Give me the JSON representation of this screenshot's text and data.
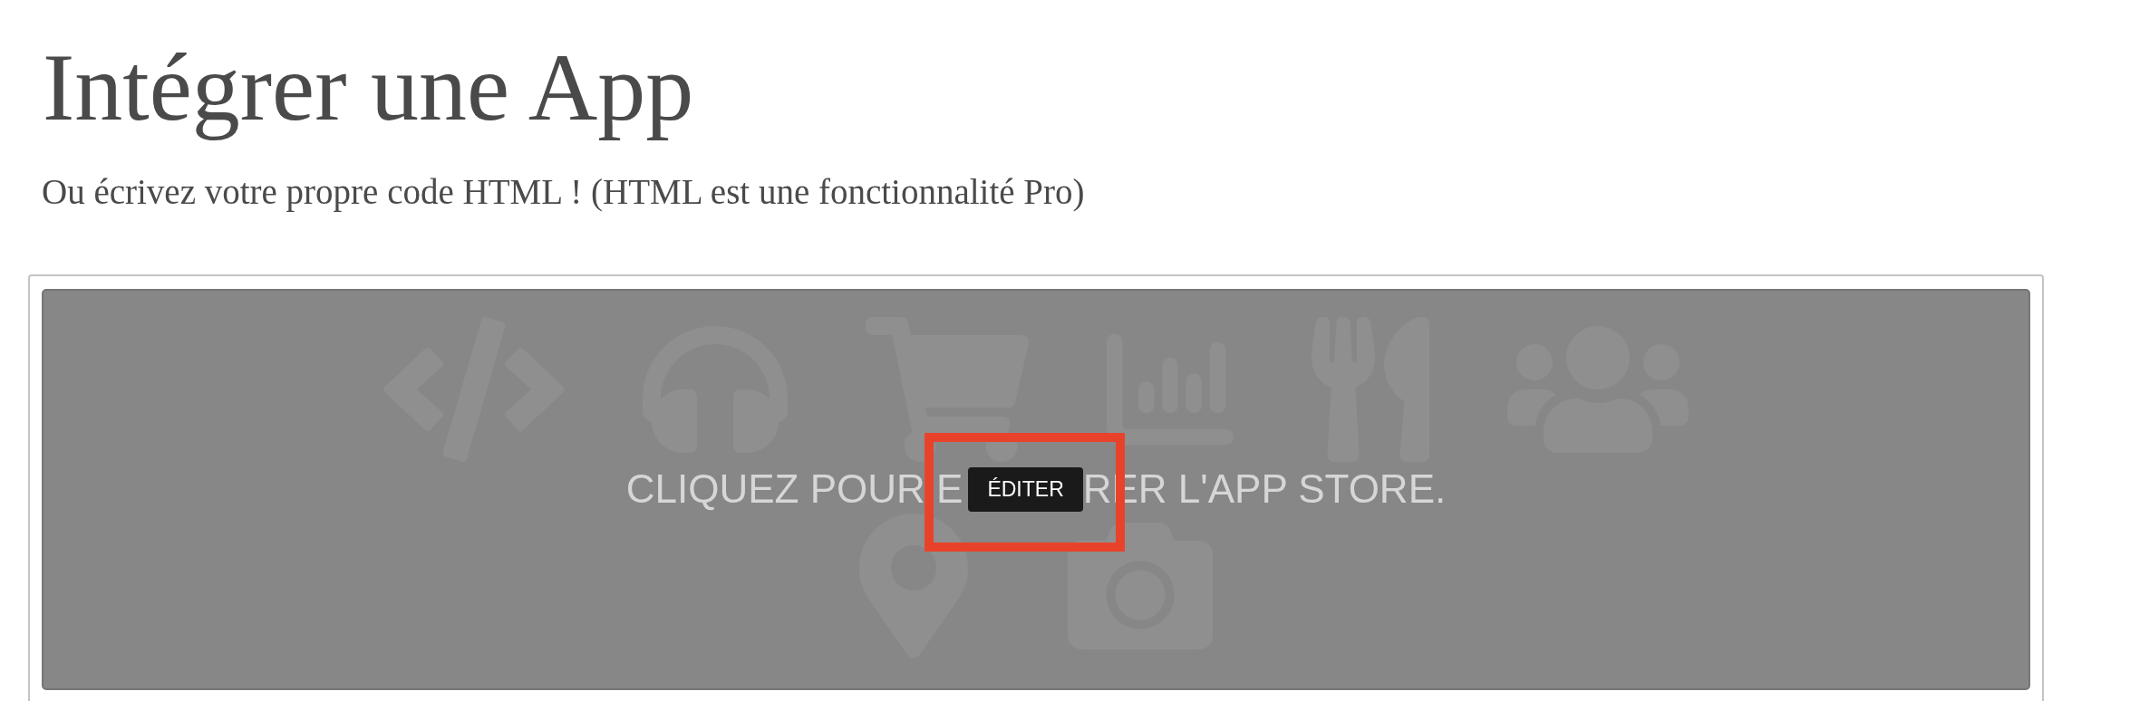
{
  "heading": {
    "title": "Intégrer une App",
    "subtitle": "Ou écrivez votre propre code HTML ! (HTML est une fonctionnalité Pro)"
  },
  "app_store_placeholder": {
    "prompt_before": "CLIQUEZ POUR E",
    "prompt_after": "RER L'APP STORE.",
    "edit_badge": {
      "label": "ÉDITER",
      "highlighted": true
    }
  }
}
